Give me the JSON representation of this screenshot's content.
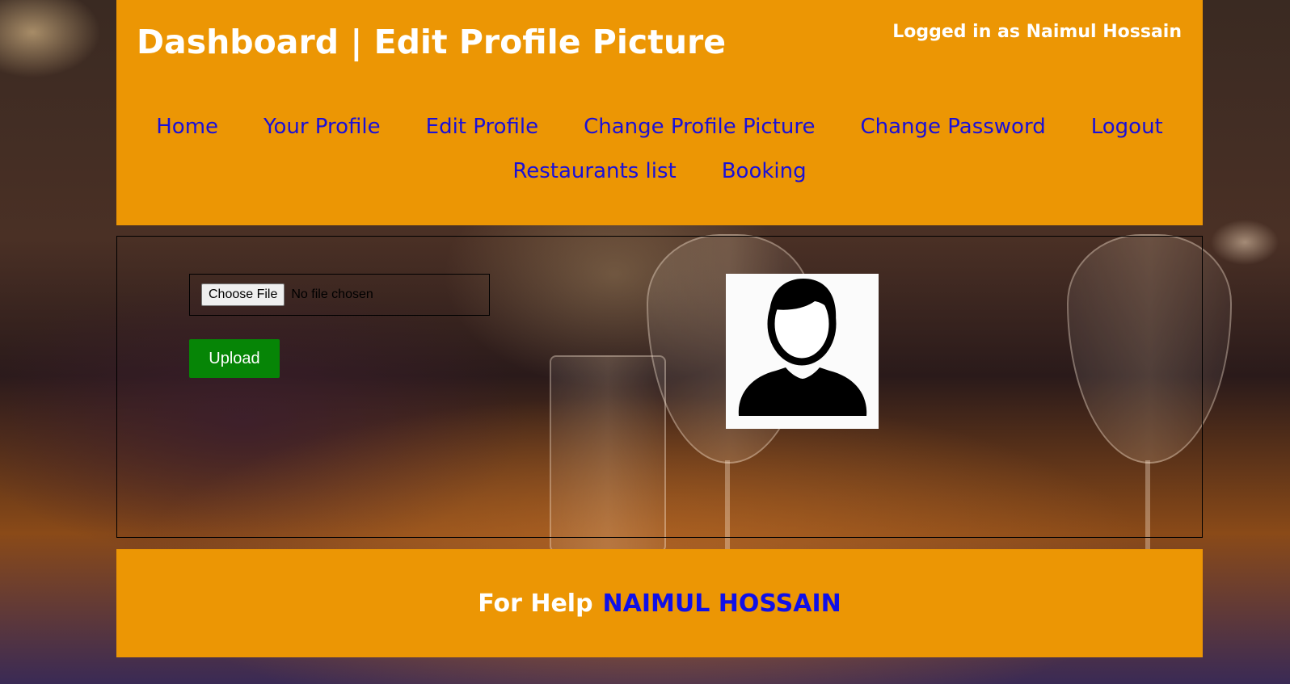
{
  "header": {
    "title": "Dashboard | Edit Profile Picture",
    "logged_in": "Logged in as Naimul Hossain"
  },
  "nav": {
    "items": [
      "Home",
      "Your Profile",
      "Edit Profile",
      "Change Profile Picture",
      "Change Password",
      "Logout",
      "Restaurants list",
      "Booking"
    ]
  },
  "form": {
    "choose_file_label": "Choose File",
    "no_file_text": "No file chosen",
    "upload_label": "Upload"
  },
  "avatar": {
    "icon": "user-silhouette-icon"
  },
  "footer": {
    "help_text": "For Help",
    "name": "NAIMUL HOSSAIN"
  },
  "colors": {
    "header_bg": "#ec9604",
    "link": "#1a10d8",
    "upload_bg": "#068506",
    "footer_name": "#1010e8"
  }
}
